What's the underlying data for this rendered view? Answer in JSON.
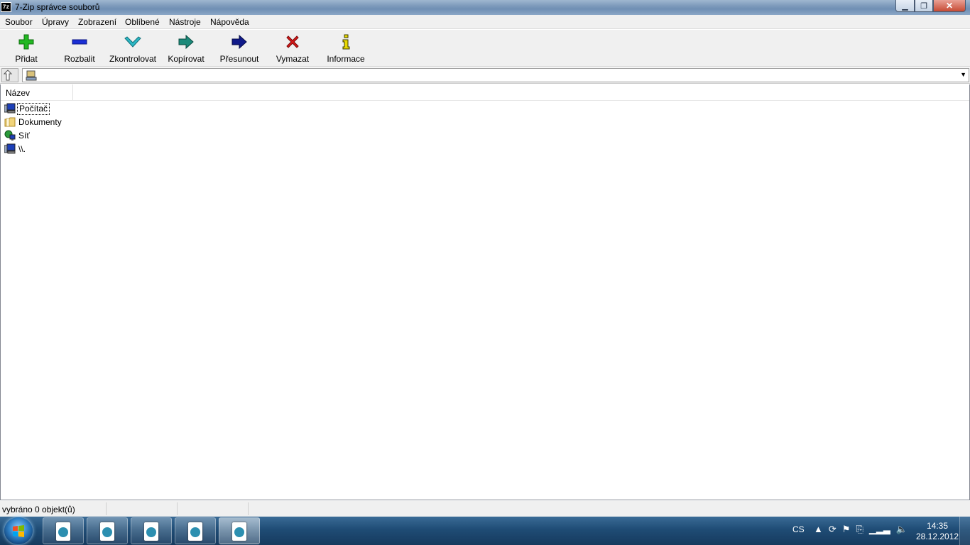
{
  "window": {
    "app_icon_text": "7z",
    "title": "7-Zip správce souborů",
    "min_glyph": "▁",
    "max_glyph": "❐",
    "close_glyph": "✕"
  },
  "menu": {
    "items": [
      {
        "label": "Soubor"
      },
      {
        "label": "Úpravy"
      },
      {
        "label": "Zobrazení"
      },
      {
        "label": "Oblíbené"
      },
      {
        "label": "Nástroje"
      },
      {
        "label": "Nápověda"
      }
    ]
  },
  "toolbar": {
    "buttons": [
      {
        "label": "Přidat",
        "icon": "plus-icon",
        "color": "#22b822"
      },
      {
        "label": "Rozbalit",
        "icon": "minus-icon",
        "color": "#1a2fd6"
      },
      {
        "label": "Zkontrolovat",
        "icon": "check-icon",
        "color": "#2bb7c4"
      },
      {
        "label": "Kopírovat",
        "icon": "arrow-right-teal-icon",
        "color": "#1c8a7a"
      },
      {
        "label": "Přesunout",
        "icon": "arrow-right-navy-icon",
        "color": "#101a8a"
      },
      {
        "label": "Vymazat",
        "icon": "delete-x-icon",
        "color": "#d81818"
      },
      {
        "label": "Informace",
        "icon": "info-icon",
        "color": "#d6c400"
      }
    ]
  },
  "address": {
    "value": ""
  },
  "list": {
    "columns": [
      {
        "label": "Název"
      }
    ],
    "items": [
      {
        "label": "Počítač",
        "icon": "computer-icon"
      },
      {
        "label": "Dokumenty",
        "icon": "folder-icon"
      },
      {
        "label": "Síť",
        "icon": "network-icon"
      },
      {
        "label": "\\\\.",
        "icon": "computer-icon"
      }
    ]
  },
  "status": {
    "selected_text": "vybráno 0 objekt(ů)"
  },
  "taskbar": {
    "language": "CS",
    "time": "14:35",
    "date": "28.12.2012"
  }
}
